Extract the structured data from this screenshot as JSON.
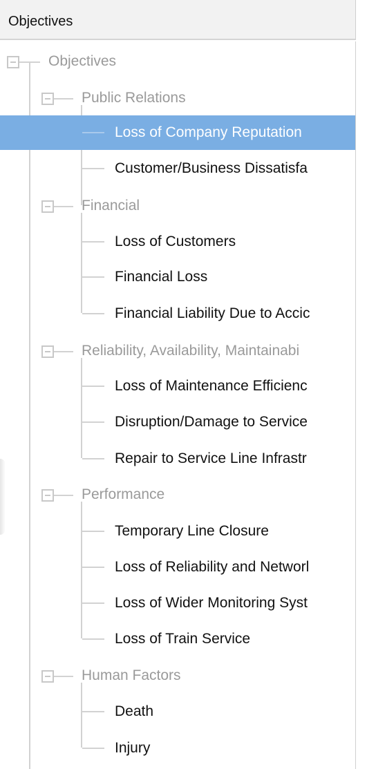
{
  "header": {
    "title": "Objectives"
  },
  "tree": {
    "root": {
      "label": "Objectives",
      "expanded": true
    },
    "groups": [
      {
        "label": "Public Relations",
        "expanded": true,
        "children": [
          {
            "label": "Loss of Company Reputation",
            "selected": true
          },
          {
            "label": "Customer/Business Dissatisfa"
          }
        ]
      },
      {
        "label": "Financial",
        "expanded": true,
        "children": [
          {
            "label": "Loss of Customers"
          },
          {
            "label": "Financial Loss"
          },
          {
            "label": "Financial Liability Due to Accic"
          }
        ]
      },
      {
        "label": "Reliability, Availability, Maintainabi",
        "expanded": true,
        "children": [
          {
            "label": "Loss of Maintenance Efficienc"
          },
          {
            "label": "Disruption/Damage to Service"
          },
          {
            "label": "Repair to Service Line Infrastr"
          }
        ]
      },
      {
        "label": "Performance",
        "expanded": true,
        "children": [
          {
            "label": "Temporary Line Closure"
          },
          {
            "label": "Loss of Reliability and Networl"
          },
          {
            "label": "Loss of Wider Monitoring Syst"
          },
          {
            "label": "Loss of Train Service"
          }
        ]
      },
      {
        "label": "Human Factors",
        "expanded": true,
        "children": [
          {
            "label": "Death"
          },
          {
            "label": "Injury"
          }
        ]
      }
    ]
  },
  "colors": {
    "selected_row": "#7aaee3",
    "tree_lines": "#d2d2d2",
    "group_text": "#9a9a9a",
    "leaf_text": "#111111"
  }
}
